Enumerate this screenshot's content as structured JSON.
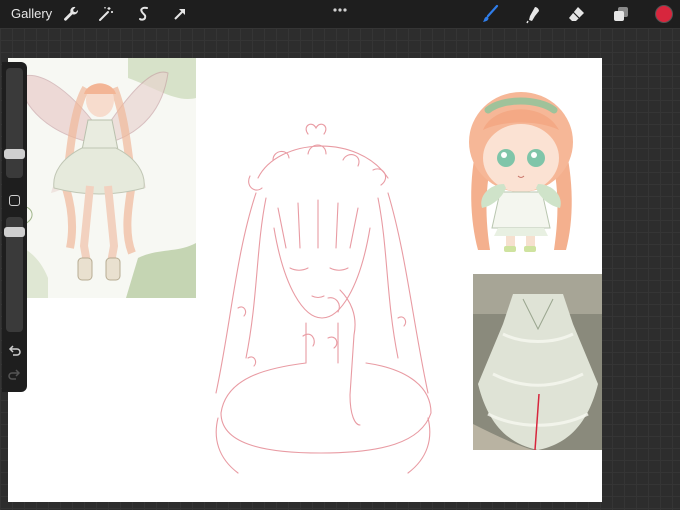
{
  "topbar": {
    "gallery_label": "Gallery",
    "left_tools": [
      "wrench-icon",
      "magic-wand-icon",
      "selection-icon",
      "transform-arrow-icon"
    ],
    "right_tools": [
      "brush-icon",
      "smudge-icon",
      "eraser-icon",
      "layers-icon"
    ],
    "active_tool": "brush-icon",
    "current_color": "#d7263d"
  },
  "sidebar": {
    "brush_size_level": 0.55,
    "opacity_level": 0.65,
    "tools": [
      "modify-square-icon",
      "undo-icon",
      "redo-icon"
    ]
  },
  "canvas": {
    "background": "#ffffff",
    "sketch_color": "#e58a93",
    "reference_images": [
      "fairy-reference-image",
      "chibi-reference-image",
      "dress-photo-reference-image"
    ]
  }
}
